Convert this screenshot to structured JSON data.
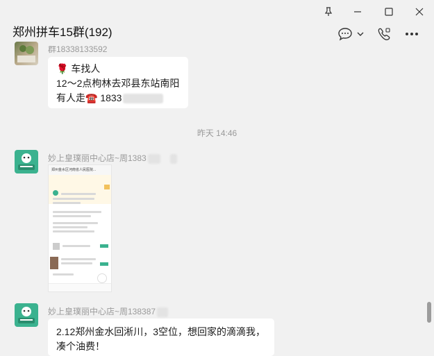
{
  "window": {
    "title": "郑州拼车15群(192)",
    "controls": [
      "pin-icon",
      "minimize-icon",
      "maximize-icon",
      "close-icon"
    ]
  },
  "header_actions": [
    "chat-bubble-icon",
    "chevron-down-icon",
    "phone-video-icon",
    "more-icon"
  ],
  "messages": [
    {
      "sender_partial": "群18338133592",
      "avatar": "photo",
      "lines": [
        "🌹 车找人",
        "12～2点枸林去邓县东站南阳",
        "有人走☎️ 1833"
      ]
    },
    {
      "timestamp": "昨天 14:46"
    },
    {
      "sender": "妙上皇璞丽中心店~周1383",
      "avatar": "妙上皇",
      "type": "image",
      "image_caption": "郑州金水区河南省人民医院..."
    },
    {
      "sender": "妙上皇璞丽中心店~周138387",
      "avatar": "妙上皇",
      "lines": [
        "2.12郑州金水回淅川，3空位，想回家的滴滴我，",
        "凑个油费！"
      ]
    }
  ],
  "colors": {
    "background": "#f1f1f1",
    "bubble": "#ffffff",
    "brand_green": "#3bb28f"
  }
}
